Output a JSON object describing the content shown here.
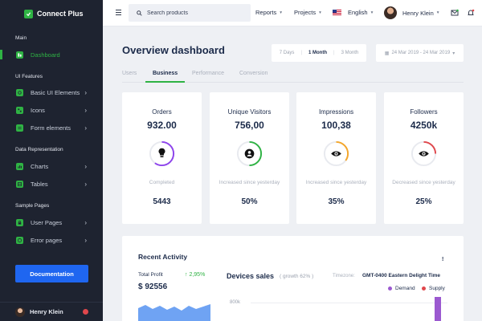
{
  "brand": {
    "name": "Connect Plus"
  },
  "sidebar": {
    "sections": [
      {
        "title": "Main"
      },
      {
        "title": "UI Features"
      },
      {
        "title": "Data Representation"
      },
      {
        "title": "Sample Pages"
      }
    ],
    "items": [
      {
        "label": "Dashboard",
        "icon": "dashboard-icon",
        "active": true
      },
      {
        "label": "Basic UI Elements",
        "icon": "crosshair-icon"
      },
      {
        "label": "Icons",
        "icon": "grid-icon"
      },
      {
        "label": "Form elements",
        "icon": "list-icon"
      },
      {
        "label": "Charts",
        "icon": "chart-icon"
      },
      {
        "label": "Tables",
        "icon": "table-icon"
      },
      {
        "label": "User Pages",
        "icon": "lock-icon"
      },
      {
        "label": "Error pages",
        "icon": "globe-icon"
      }
    ],
    "documentation_label": "Documentation",
    "user": {
      "name": "Henry Klein",
      "notification_count": ""
    }
  },
  "topbar": {
    "search_placeholder": "Search products",
    "menus": [
      "Reports",
      "Projects"
    ],
    "language": "English",
    "user_name": "Henry Klein"
  },
  "main": {
    "title": "Overview dashboard",
    "periods": [
      "7 Days",
      "1 Month",
      "3 Month"
    ],
    "active_period": "1 Month",
    "date_range": "24 Mar 2019 - 24 Mar 2019",
    "tabs": [
      "Users",
      "Business",
      "Performance",
      "Conversion"
    ],
    "active_tab": "Business",
    "cards": [
      {
        "title": "Orders",
        "value": "932.00",
        "sub": "Completed",
        "sub_value": "5443",
        "color": "#8e44ec",
        "icon": "lightbulb-icon",
        "progress": 0.6
      },
      {
        "title": "Unique Visitors",
        "value": "756,00",
        "sub": "Increased since yesterday",
        "sub_value": "50%",
        "color": "#2fb344",
        "icon": "user-icon",
        "progress": 0.5
      },
      {
        "title": "Impressions",
        "value": "100,38",
        "sub": "Increased since yesterday",
        "sub_value": "35%",
        "color": "#f4a62a",
        "icon": "eye-icon",
        "progress": 0.35
      },
      {
        "title": "Followers",
        "value": "4250k",
        "sub": "Decreased since yesterday",
        "sub_value": "25%",
        "color": "#e0474c",
        "icon": "eye-icon",
        "progress": 0.25
      }
    ]
  },
  "activity": {
    "title": "Recent Activity",
    "menu_icon": "!",
    "profit_label": "Total Profit",
    "profit_growth": "↑ 2,95%",
    "profit_value": "$ 92556",
    "devices_title": "Devices sales",
    "devices_growth": "( growth 62% )",
    "timezone_label": "Timezone:",
    "timezone_value": "GMT-0400 Eastern Delight Time",
    "legend": [
      {
        "label": "Demand",
        "color": "#9b59d0"
      },
      {
        "label": "Supply",
        "color": "#e0474c"
      }
    ],
    "y_tick": "800k"
  }
}
